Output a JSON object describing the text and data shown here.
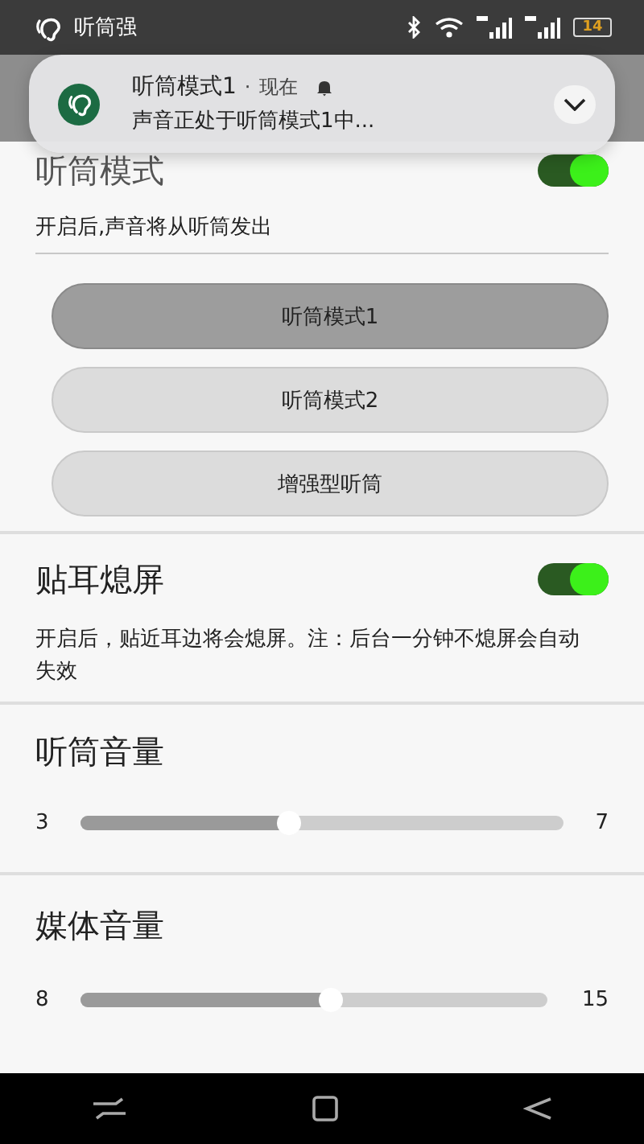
{
  "status_bar": {
    "app_name": "听筒强",
    "battery": "14"
  },
  "notification": {
    "title": "听筒模式1",
    "separator": "·",
    "time": "现在",
    "text": "声音正处于听筒模式1中..."
  },
  "receiver_mode": {
    "title": "听筒模式",
    "on": true,
    "description": "开启后,声音将从听筒发出",
    "modes": [
      {
        "label": "听筒模式1",
        "selected": true
      },
      {
        "label": "听筒模式2",
        "selected": false
      },
      {
        "label": "增强型听筒",
        "selected": false
      }
    ]
  },
  "proximity_off": {
    "title": "贴耳熄屏",
    "on": true,
    "description": "开启后，贴近耳边将会熄屏。注：后台一分钟不熄屏会自动失效"
  },
  "volumes": [
    {
      "title": "听筒音量",
      "min": "3",
      "max": "7",
      "level": 0.43
    },
    {
      "title": "媒体音量",
      "min": "8",
      "max": "15",
      "level": 0.535
    }
  ]
}
